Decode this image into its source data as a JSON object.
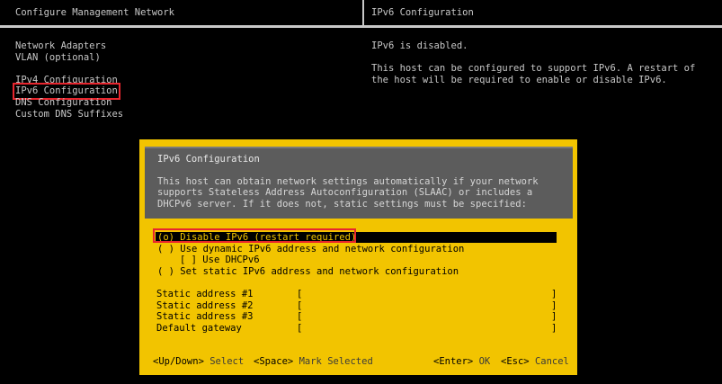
{
  "header": {
    "left_title": "Configure Management Network",
    "right_title": "IPv6 Configuration"
  },
  "menu": {
    "items": [
      "Network Adapters",
      "VLAN (optional)",
      "IPv4 Configuration",
      "IPv6 Configuration",
      "DNS Configuration",
      "Custom DNS Suffixes"
    ],
    "selected_index": 3
  },
  "info_panel": {
    "status": "IPv6 is disabled.",
    "description_line1": "This host can be configured to support IPv6. A restart of",
    "description_line2": "the host will be required to enable or disable IPv6."
  },
  "dialog": {
    "title": "IPv6 Configuration",
    "intro_line1": "This host can obtain network settings automatically if your network",
    "intro_line2": "supports Stateless Address Autoconfiguration (SLAAC) or includes a",
    "intro_line3": "DHCPv6 server. If it does not, static settings must be specified:",
    "options": [
      {
        "marker": "(o)",
        "label": "Disable IPv6 (restart required)"
      },
      {
        "marker": "( )",
        "label": "Use dynamic IPv6 address and network configuration"
      },
      {
        "marker": "[ ]",
        "label": "Use DHCPv6"
      },
      {
        "marker": "( )",
        "label": "Set static IPv6 address and network configuration"
      }
    ],
    "fields": [
      {
        "label": "Static address #1"
      },
      {
        "label": "Static address #2"
      },
      {
        "label": "Static address #3"
      },
      {
        "label": "Default gateway"
      }
    ],
    "field_open": "[",
    "field_close": "]",
    "footer": {
      "nav_key": "<Up/Down>",
      "nav_label": "Select",
      "space_key": "<Space>",
      "space_label": "Mark Selected",
      "enter_key": "<Enter>",
      "enter_label": "OK",
      "esc_key": "<Esc>",
      "esc_label": "Cancel"
    }
  },
  "colors": {
    "background": "#000000",
    "text": "#c8c8c8",
    "dialog": "#f2c400",
    "dialog_header": "#5c5c5c",
    "annotation": "#e8262e"
  }
}
